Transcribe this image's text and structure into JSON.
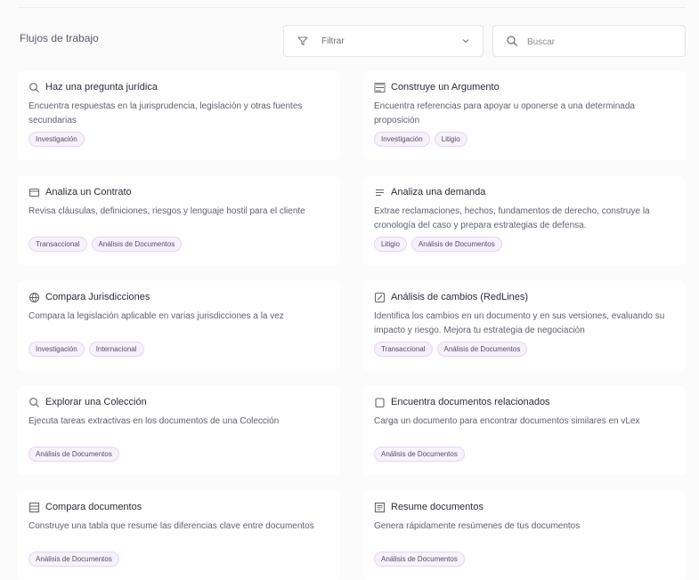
{
  "page": {
    "title": "Flujos de trabajo"
  },
  "filter": {
    "icon": "filter-icon",
    "value": "Filtrar"
  },
  "search": {
    "icon": "search-icon",
    "placeholder": "Buscar"
  },
  "cards": [
    {
      "icon": "search-icon",
      "title": "Haz una pregunta jurídica",
      "description": "Encuentra respuestas en la jurisprudencia, legislación y otras fuentes secundarias",
      "tags": [
        "Investigación"
      ]
    },
    {
      "icon": "list-icon",
      "title": "Construye un Argumento",
      "description": "Encuentra referencias para apoyar u oponerse a una determinada proposición",
      "tags": [
        "Investigación",
        "Litigio"
      ]
    },
    {
      "icon": "document-icon",
      "title": "Analiza un Contrato",
      "description": "Revisa cláusulas, definiciones, riesgos y lenguaje hostil para el cliente",
      "tags": [
        "Transaccional",
        "Análisis de Documentos"
      ]
    },
    {
      "icon": "lines-icon",
      "title": "Analiza una demanda",
      "description": "Extrae reclamaciones, hechos, fundamentos de derecho, construye la cronología del caso y prepara estrategias de defensa.",
      "tags": [
        "Litigio",
        "Análisis de Documentos"
      ]
    },
    {
      "icon": "globe-icon",
      "title": "Compara Jurisdicciones",
      "description": "Compara la legislación aplicable en varias jurisdicciones a la vez",
      "tags": [
        "Investigación",
        "Internacional"
      ]
    },
    {
      "icon": "edit-icon",
      "title": "Análisis de cambios (RedLines)",
      "description": "Identifica los cambios en un documento y en sus versiones, evaluando su impacto y riesgo. Mejora tu estrategia de negociación",
      "tags": [
        "Transaccional",
        "Análisis de Documentos"
      ]
    },
    {
      "icon": "search-icon",
      "title": "Explorar una Colección",
      "description": "Ejecuta tareas extractivas en los documentos de una Colección",
      "tags": [
        "Análisis de Documentos"
      ]
    },
    {
      "icon": "copy-icon",
      "title": "Encuentra documentos relacionados",
      "description": "Carga un documento para encontrar documentos similares en vLex",
      "tags": [
        "Análisis de Documentos"
      ]
    },
    {
      "icon": "table-icon",
      "title": "Compara documentos",
      "description": "Construye una tabla que resume las diferencias clave entre documentos",
      "tags": [
        "Análisis de Documentos"
      ]
    },
    {
      "icon": "summary-icon",
      "title": "Resume documentos",
      "description": "Genera rápidamente resúmenes de tus documentos",
      "tags": [
        "Análisis de Documentos"
      ]
    }
  ]
}
